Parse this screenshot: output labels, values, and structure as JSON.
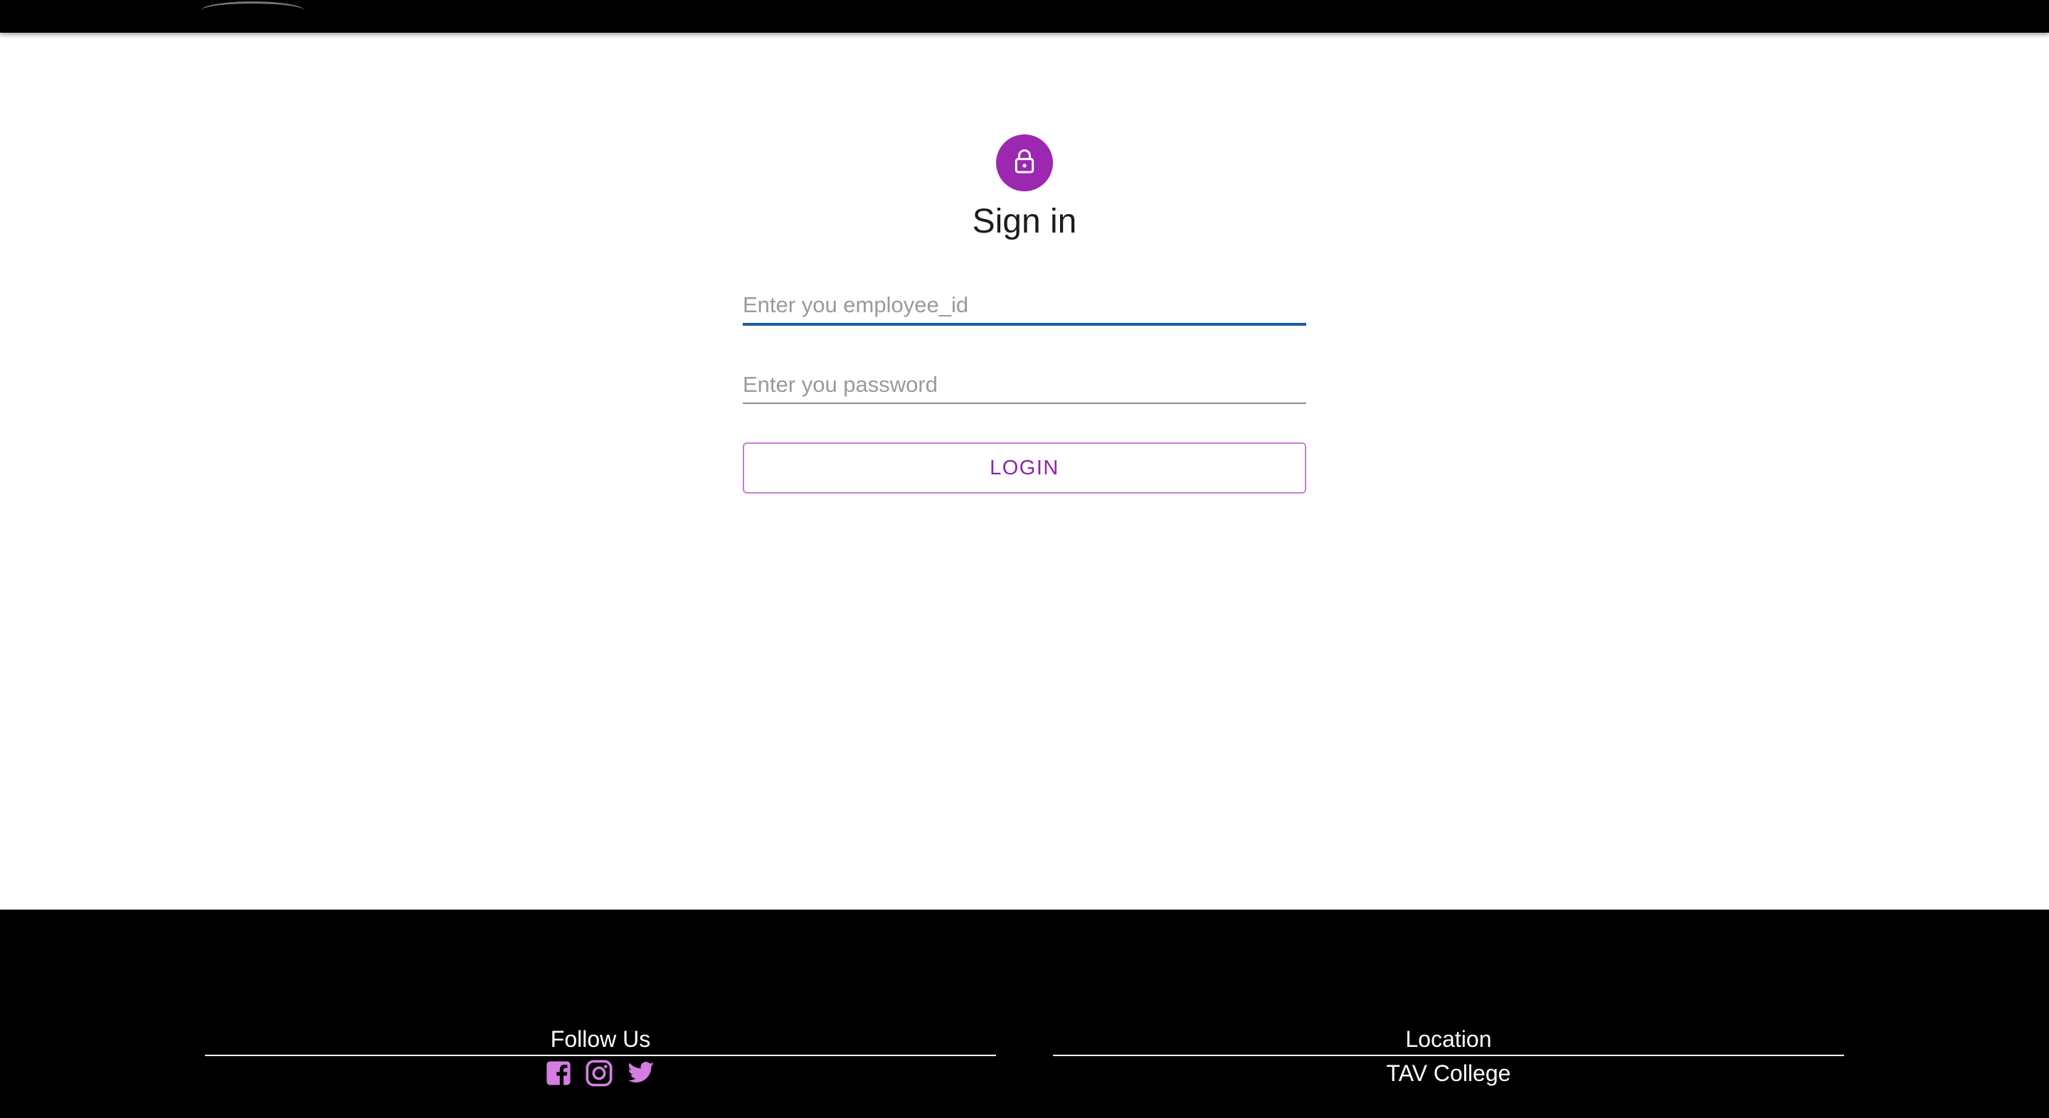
{
  "colors": {
    "accent": "#9c27b0",
    "button_text": "#8e24aa",
    "button_border": "#c77ed4",
    "focus_line": "#1e5aa8",
    "social_icon": "#d37ee0",
    "header_bg": "#000000",
    "footer_bg": "#000000"
  },
  "signin": {
    "icon": "lock-icon",
    "title": "Sign in",
    "employee_id": {
      "placeholder": "Enter you employee_id",
      "value": ""
    },
    "password": {
      "placeholder": "Enter you password",
      "value": ""
    },
    "login_label": "LOGIN"
  },
  "footer": {
    "follow": {
      "heading": "Follow Us",
      "icons": [
        "facebook-icon",
        "instagram-icon",
        "twitter-icon"
      ]
    },
    "location": {
      "heading": "Location",
      "text": "TAV College"
    }
  }
}
